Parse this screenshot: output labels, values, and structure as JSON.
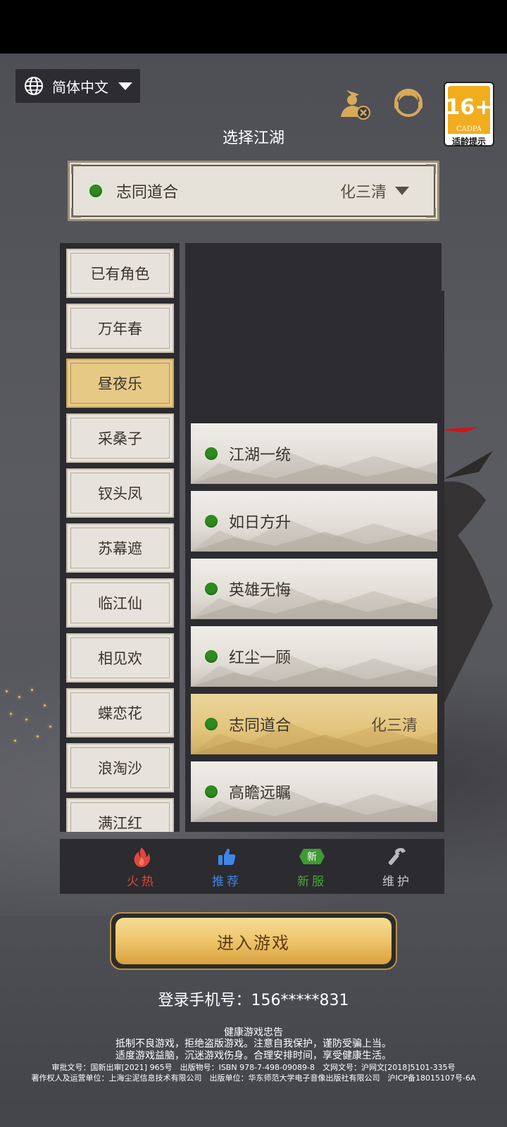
{
  "language": {
    "label": "简体中文"
  },
  "age_rating": {
    "number": "16+",
    "org": "CADPA",
    "tip": "适龄提示"
  },
  "title": "选择江湖",
  "selected_server": {
    "name": "志同道合",
    "zone": "化三清",
    "status_color": "#2e8b1e"
  },
  "zones": [
    {
      "label": "已有角色"
    },
    {
      "label": "万年春"
    },
    {
      "label": "昼夜乐",
      "selected": true
    },
    {
      "label": "采桑子"
    },
    {
      "label": "钗头凤"
    },
    {
      "label": "苏幕遮"
    },
    {
      "label": "临江仙"
    },
    {
      "label": "相见欢"
    },
    {
      "label": "蝶恋花"
    },
    {
      "label": "浪淘沙"
    },
    {
      "label": "满江红"
    }
  ],
  "servers": [
    {
      "name": "江湖一统",
      "zone": ""
    },
    {
      "name": "如日方升",
      "zone": ""
    },
    {
      "name": "英雄无悔",
      "zone": ""
    },
    {
      "name": "红尘一顾",
      "zone": ""
    },
    {
      "name": "志同道合",
      "zone": "化三清",
      "selected": true
    },
    {
      "name": "高瞻远瞩",
      "zone": ""
    }
  ],
  "tabs": [
    {
      "label": "火热",
      "icon": "fire-icon",
      "color": "#e0463c"
    },
    {
      "label": "推荐",
      "icon": "thumbs-up-icon",
      "color": "#3f86e6"
    },
    {
      "label": "新服",
      "icon": "new-badge-icon",
      "badge": "新",
      "color": "#4aa53a"
    },
    {
      "label": "维护",
      "icon": "wrench-icon",
      "color": "#c9c9c9"
    }
  ],
  "enter_button": "进入游戏",
  "phone_login": "登录手机号：156*****831",
  "notice": {
    "heading": "健康游戏忠告",
    "line1": "抵制不良游戏，拒绝盗版游戏。注意自我保护，谨防受骗上当。",
    "line2": "适度游戏益脑，沉迷游戏伤身。合理安排时间，享受健康生活。",
    "line3": "审批文号：国新出审[2021] 965号　出版物号：ISBN 978-7-498-09089-8　文网文号：沪网文[2018]5101-335号",
    "line4": "著作权人及运营单位：上海尘泥信息技术有限公司　出版单位：华东师范大学电子音像出版社有限公司　沪ICP备18015107号-6A"
  }
}
